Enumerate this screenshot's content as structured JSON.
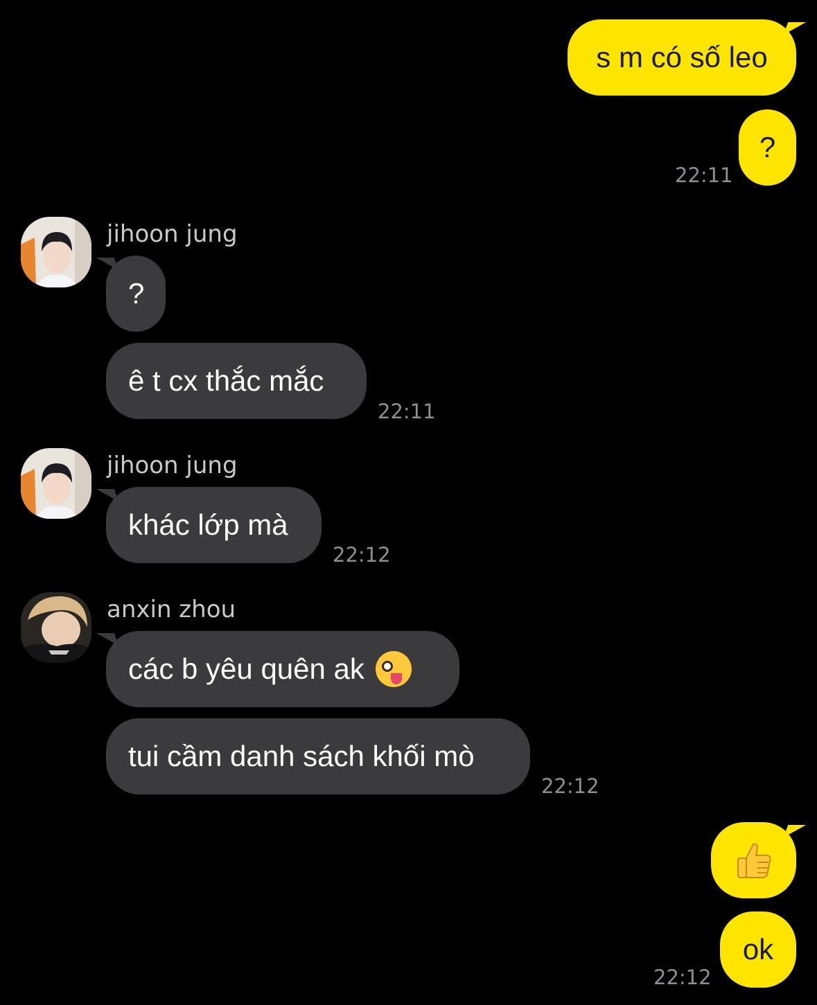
{
  "messages": {
    "m1": {
      "text": "s m có số leo"
    },
    "m2": {
      "text": "?",
      "time": "22:11"
    },
    "g1": {
      "sender": "jihoon jung",
      "b1": "?",
      "b2": "ê t cx thắc mắc",
      "time": "22:11"
    },
    "g2": {
      "sender": "jihoon jung",
      "b1": "khác lớp mà",
      "time": "22:12"
    },
    "g3": {
      "sender": "anxin zhou",
      "b1": "các b yêu quên ak",
      "b2": "tui cầm danh sách khối mò",
      "time": "22:12"
    },
    "m3": {
      "emoji": "thumbs-up"
    },
    "m4": {
      "text": "ok",
      "time": "22:12"
    }
  },
  "colors": {
    "background": "#000000",
    "my_bubble": "#fee500",
    "their_bubble": "#3b3b3d",
    "timestamp": "#8e8e93"
  }
}
